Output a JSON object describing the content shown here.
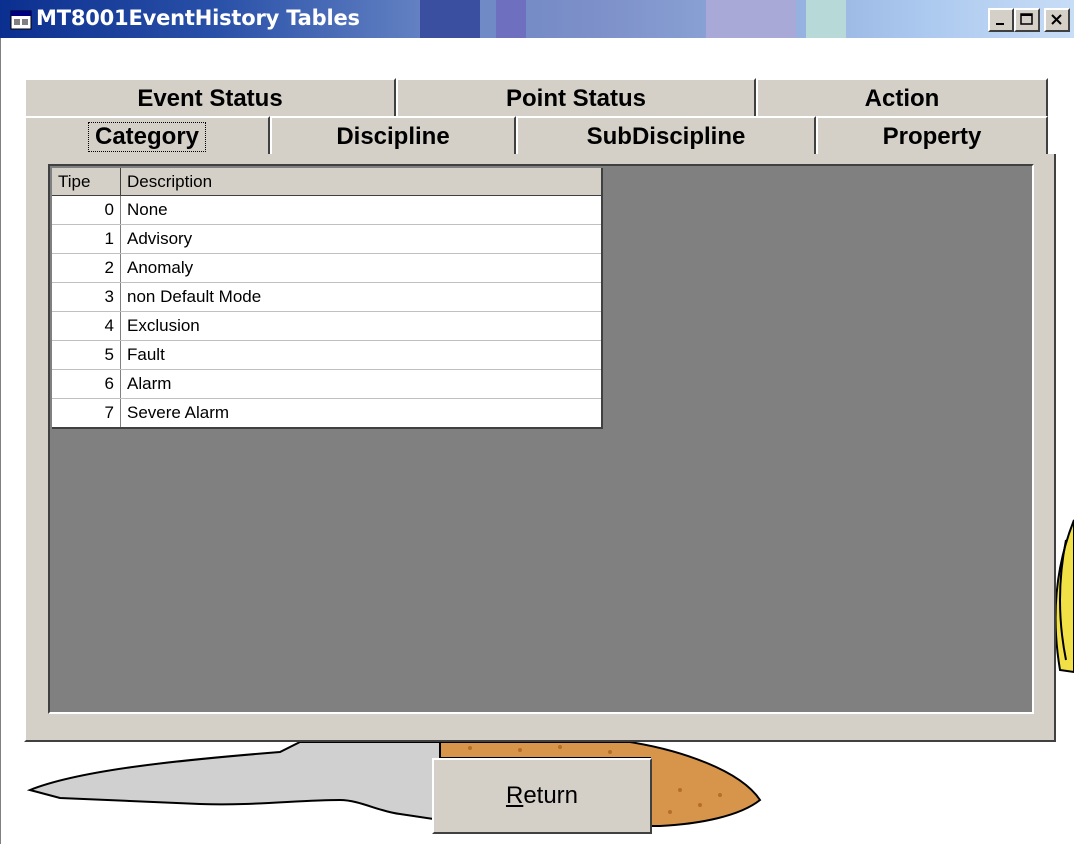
{
  "window": {
    "title": "MT8001EventHistory Tables",
    "controls": {
      "minimize": "minimize-icon",
      "maximize": "maximize-icon",
      "close": "close-icon"
    }
  },
  "tabs": {
    "back_row": [
      "Event Status",
      "Point Status",
      "Action"
    ],
    "front_row": [
      "Category",
      "Discipline",
      "SubDiscipline",
      "Property"
    ],
    "selected": "Category"
  },
  "table": {
    "columns": [
      "Tipe",
      "Description"
    ],
    "rows": [
      {
        "tipe": "0",
        "description": "None"
      },
      {
        "tipe": "1",
        "description": "Advisory"
      },
      {
        "tipe": "2",
        "description": "Anomaly"
      },
      {
        "tipe": "3",
        "description": "non Default Mode"
      },
      {
        "tipe": "4",
        "description": "Exclusion"
      },
      {
        "tipe": "5",
        "description": "Fault"
      },
      {
        "tipe": "6",
        "description": "Alarm"
      },
      {
        "tipe": "7",
        "description": "Severe Alarm"
      }
    ]
  },
  "buttons": {
    "return_rest": "eturn",
    "return_mnemonic": "R"
  },
  "colors": {
    "title_bar_start": "#0b2f8f",
    "title_bar_end": "#c8ddf6",
    "panel": "#d4d0c8",
    "grid_background": "#808080"
  }
}
